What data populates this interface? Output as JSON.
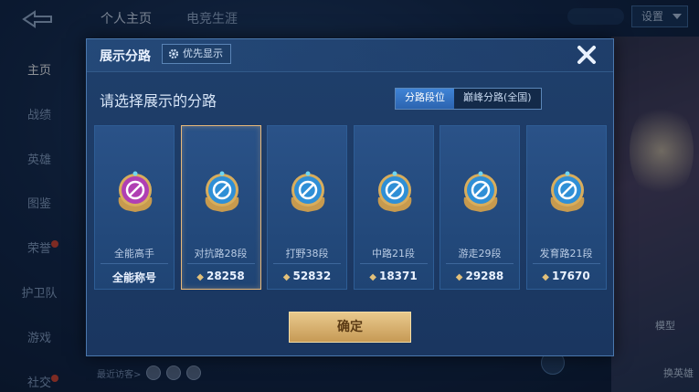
{
  "background": {
    "top_tabs": [
      "个人主页",
      "电竞生涯"
    ],
    "settings_label": "设置",
    "side_nav": [
      "主页",
      "战绩",
      "英雄",
      "图鉴",
      "荣誉",
      "护卫队",
      "游戏",
      "社交"
    ],
    "visitors_label": "最近访客>",
    "model_label": "模型",
    "swap_hero_label": "换英雄"
  },
  "modal": {
    "title": "展示分路",
    "priority_label": "优先显示",
    "subtitle": "请选择展示的分路",
    "segments": [
      "分路段位",
      "巅峰分路(全国)"
    ],
    "active_segment": 0,
    "confirm_label": "确定",
    "cards": [
      {
        "rank": "全能高手",
        "points": "全能称号",
        "emblem": "all-round-emblem-icon",
        "color": "#b03fb3",
        "selected": false
      },
      {
        "rank": "对抗路28段",
        "points": "28258",
        "emblem": "clash-lane-emblem-icon",
        "color": "#2f8fd6",
        "selected": true
      },
      {
        "rank": "打野38段",
        "points": "52832",
        "emblem": "jungle-emblem-icon",
        "color": "#2f8fd6",
        "selected": false
      },
      {
        "rank": "中路21段",
        "points": "18371",
        "emblem": "mid-lane-emblem-icon",
        "color": "#2f8fd6",
        "selected": false
      },
      {
        "rank": "游走29段",
        "points": "29288",
        "emblem": "roam-emblem-icon",
        "color": "#2f8fd6",
        "selected": false
      },
      {
        "rank": "发育路21段",
        "points": "17670",
        "emblem": "farm-lane-emblem-icon",
        "color": "#2f8fd6",
        "selected": false
      }
    ]
  },
  "colors": {
    "accent_gold": "#e8b97a",
    "panel": "#1f3f6b",
    "active_tab": "#3f84d6"
  }
}
